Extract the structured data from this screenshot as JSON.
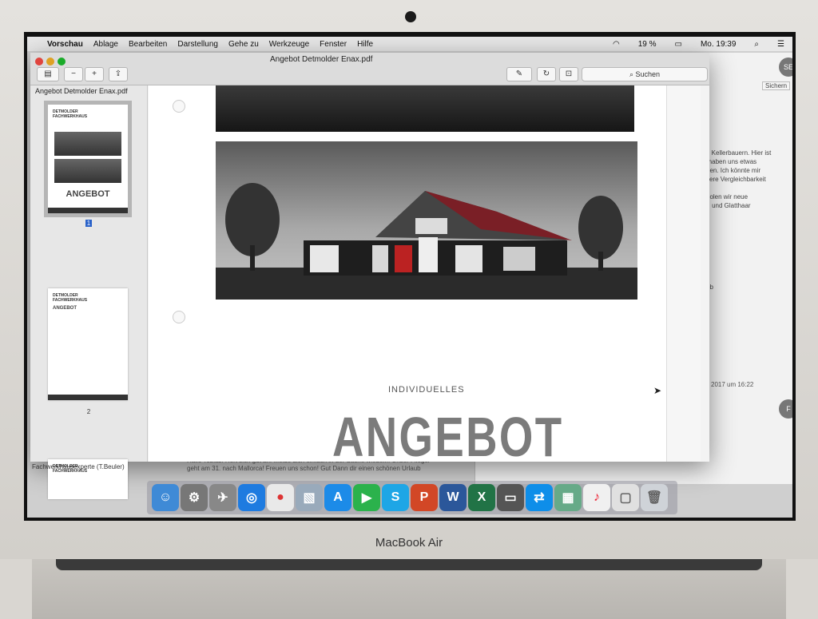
{
  "menubar": {
    "app": "Vorschau",
    "items": [
      "Ablage",
      "Bearbeiten",
      "Darstellung",
      "Gehe zu",
      "Werkzeuge",
      "Fenster",
      "Hilfe"
    ],
    "battery": "19 %",
    "clock": "Mo. 19:39"
  },
  "window": {
    "title": "Angebot Detmolder Enax.pdf",
    "search_placeholder": "Suchen"
  },
  "sidebar": {
    "file_label": "Angebot Detmolder Enax.pdf",
    "thumb_logo": "DETMOLDER\nFACHWERKHAUS",
    "thumb_title": "ANGEBOT",
    "page1": "1",
    "page2": "2",
    "footer": "Fachwerkhausexperte (T.Beuler)"
  },
  "document": {
    "subtitle": "INDIVIDUELLES",
    "title": "ANGEBOT"
  },
  "background_window": {
    "avatar_top": "SE",
    "avatar_bottom": "F",
    "save_button": "Sichern",
    "partial_text": "n Kellerbauern. Hier ist\n(haben uns etwas\nden. Ich könnte mir\nsere Vergleichbarkeit\n\nholen wir neue\n)  und Glatthaar",
    "partial_text2": "eb",
    "date": "2017 um 16:22",
    "bottom_text": "Hallo Tobias! Hört sich gut an. Melde dich einfach in der Sache wieder... Unser Flieger\ngeht am 31. nach Mallorca! Freuen uns schon! Gut Dann dir einen schönen Urlaub"
  },
  "dock": {
    "icons": [
      "finder-icon",
      "system-preferences-icon",
      "launchpad-icon",
      "safari-icon",
      "chrome-icon",
      "preview-icon",
      "app-store-icon",
      "facetime-icon",
      "skype-icon",
      "powerpoint-icon",
      "word-icon",
      "excel-icon",
      "scanner-icon",
      "teamviewer-icon",
      "photos-icon",
      "itunes-icon",
      "folder-icon",
      "trash-icon"
    ]
  },
  "laptop": {
    "brand": "MacBook Air"
  }
}
